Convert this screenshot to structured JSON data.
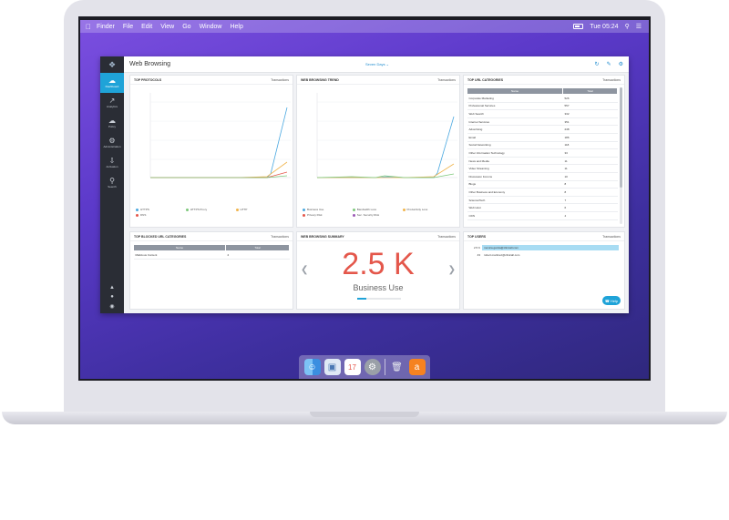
{
  "menubar": {
    "items": [
      "Finder",
      "File",
      "Edit",
      "View",
      "Go",
      "Window",
      "Help"
    ],
    "clock": "Tue 05:24"
  },
  "app": {
    "page_title": "Web Browsing",
    "date_range": "Seven Days  ⌄",
    "nav": [
      {
        "label": "Dashboard",
        "icon": "cloud-icon"
      },
      {
        "label": "Analytics",
        "icon": "chart-icon"
      },
      {
        "label": "Policy",
        "icon": "cloud-icon"
      },
      {
        "label": "Administration",
        "icon": "gear-icon"
      },
      {
        "label": "Activation",
        "icon": "arrow-down-icon"
      },
      {
        "label": "Search",
        "icon": "search-icon"
      }
    ]
  },
  "panels": {
    "protocols": {
      "title": "TOP PROTOCOLS",
      "action": "Transactions",
      "legend": [
        "HTTPS",
        "HTTPS Proxy",
        "HTTP",
        "DNS"
      ]
    },
    "trend": {
      "title": "WEB BROWSING TREND",
      "action": "Transactions",
      "legend": [
        "Business Use",
        "Bandwidth Loss",
        "Productivity Loss",
        "Privacy Risk",
        "Sec. Security Risk"
      ]
    },
    "url_categories": {
      "title": "TOP URL CATEGORIES",
      "action": "Transactions",
      "headers": [
        "Name",
        "Total"
      ],
      "rows": [
        [
          "Corporate Marketing",
          "526"
        ],
        [
          "Professional Services",
          "557"
        ],
        [
          "Web Search",
          "332"
        ],
        [
          "Internet Services",
          "351"
        ],
        [
          "Advertising",
          "248"
        ],
        [
          "Email",
          "186"
        ],
        [
          "Social Networking",
          "118"
        ],
        [
          "Other Information Technology",
          "33"
        ],
        [
          "News and Media",
          "11"
        ],
        [
          "Video Streaming",
          "11"
        ],
        [
          "Discussion Forums",
          "10"
        ],
        [
          "Blogs",
          "8"
        ],
        [
          "Other Business and Economy",
          "8"
        ],
        [
          "Science/Tech",
          "7"
        ],
        [
          "Web Host",
          "6"
        ],
        [
          "CDN",
          "4"
        ]
      ]
    },
    "blocked": {
      "title": "TOP BLOCKED URL CATEGORIES",
      "action": "Transactions",
      "headers": [
        "Name",
        "Total"
      ],
      "rows": [
        [
          "Malicious Content",
          "2"
        ]
      ]
    },
    "summary": {
      "title": "WEB BROWSING SUMMARY",
      "action": "Transactions",
      "value": "2.5 K",
      "caption": "Business Use"
    },
    "users": {
      "title": "TOP USERS",
      "action": "Transactions",
      "rows": [
        {
          "count": "2.5 K",
          "email": "monica.garcia@clinicall.com",
          "share": 1.0
        },
        {
          "count": "43",
          "email": "robert.martinez@clinicall.com",
          "share": 0.02
        }
      ]
    }
  },
  "help_label": "Help",
  "colors": {
    "accent": "#1fa3d8",
    "https": "#4aa8e0",
    "https_proxy": "#7dc87a",
    "http": "#f0b44c",
    "dns": "#e4574b",
    "summary": "#e4574b"
  },
  "dock": [
    "finder-icon",
    "preview-icon",
    "calendar-icon",
    "system-preferences-icon",
    "trash-icon",
    "avast-icon"
  ]
}
